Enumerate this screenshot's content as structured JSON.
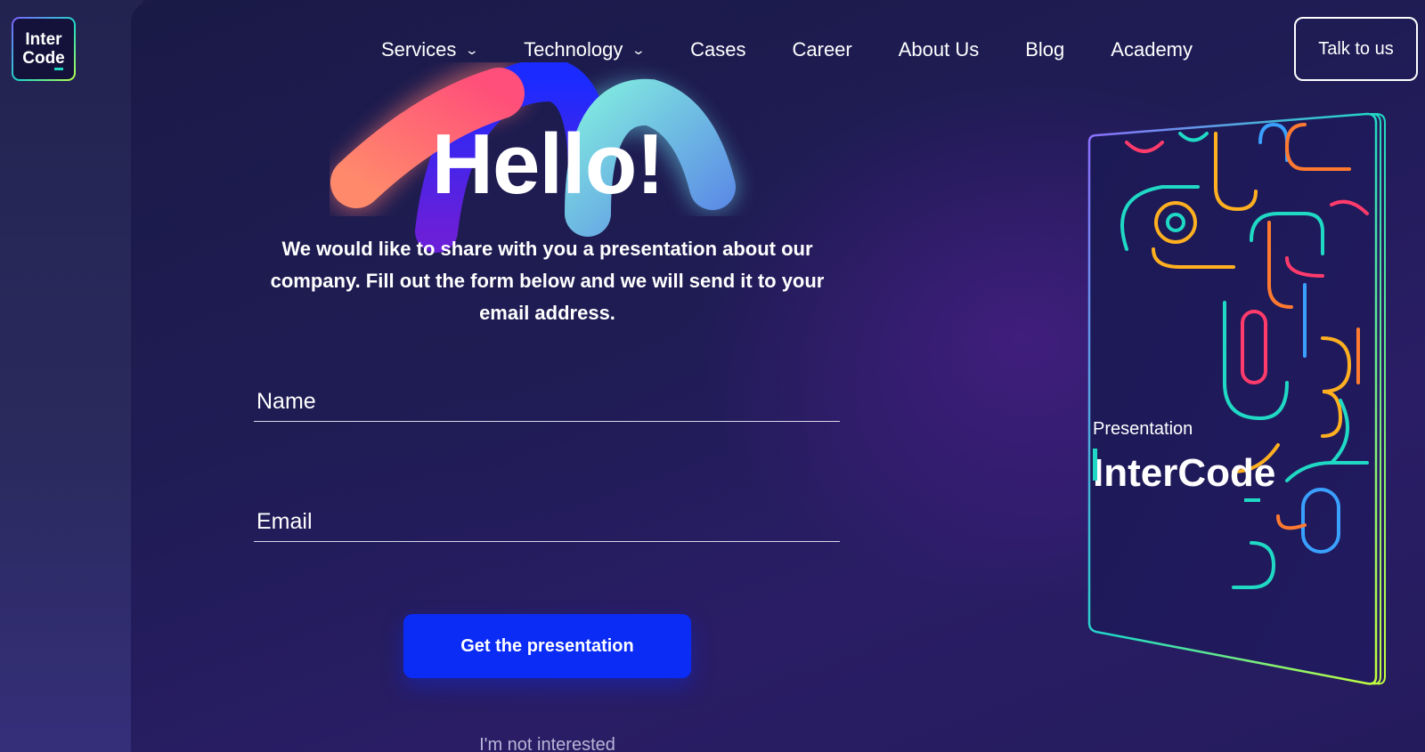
{
  "logo": {
    "line1": "Inter",
    "line2": "Code"
  },
  "nav": {
    "items": [
      {
        "label": "Services",
        "has_dropdown": true
      },
      {
        "label": "Technology",
        "has_dropdown": true
      },
      {
        "label": "Cases",
        "has_dropdown": false
      },
      {
        "label": "Career",
        "has_dropdown": false
      },
      {
        "label": "About Us",
        "has_dropdown": false
      },
      {
        "label": "Blog",
        "has_dropdown": false
      },
      {
        "label": "Academy",
        "has_dropdown": false
      }
    ],
    "cta_label": "Talk to us"
  },
  "hero": {
    "title": "Hello!",
    "intro": "We would like to share with you a presentation about our company. Fill out the form below and we will send it to your email address."
  },
  "form": {
    "name_placeholder": "Name",
    "email_placeholder": "Email",
    "name_value": "",
    "email_value": "",
    "submit_label": "Get the presentation",
    "decline_label": "I'm not interested"
  },
  "book": {
    "caption": "Presentation",
    "brand": "InterCode"
  },
  "colors": {
    "background": "#1e1c4a",
    "accent_button": "#0a2cf5",
    "brand_teal": "#20d9c5"
  }
}
